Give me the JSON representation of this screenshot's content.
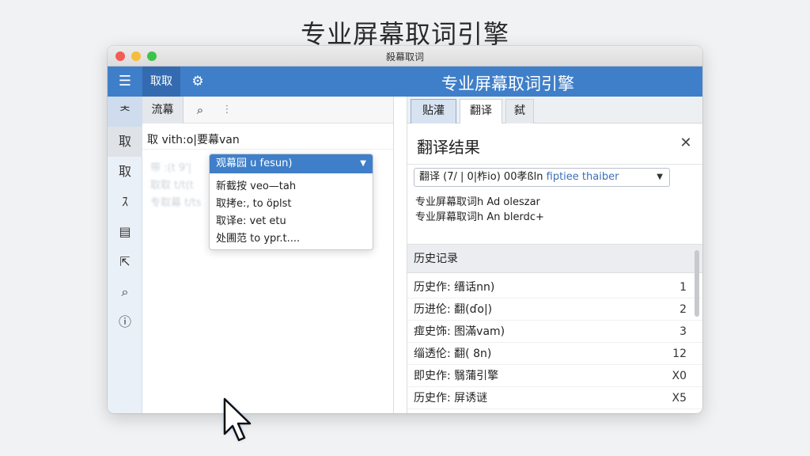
{
  "hero_title": "专业屏幕取词引擎",
  "window": {
    "title": "殺幕取词"
  },
  "appbar": {
    "menu_icon": "hamburger-icon",
    "tab_label": "取取",
    "settings_icon": "gear-icon",
    "title": "专业屏幕取词引擎"
  },
  "sidebar": {
    "items": [
      {
        "icon": "pin-icon",
        "glyph": "ᄎ"
      },
      {
        "label": "取"
      },
      {
        "label": "取"
      },
      {
        "label": "ｽ"
      },
      {
        "icon": "document-icon",
        "glyph": "▤"
      },
      {
        "icon": "export-icon",
        "glyph": "⇱"
      },
      {
        "icon": "search-doc-icon",
        "glyph": "⌕"
      },
      {
        "icon": "info-doc-icon",
        "glyph": "ⓘ"
      }
    ]
  },
  "left_panel": {
    "tab_label": "流幕",
    "search_icon": "search-icon",
    "query_text": "取 vith:o|要幕van",
    "ghost_lines": [
      "带 :(t 9'|",
      "取取 t/t(t",
      "专取幕 t/ts"
    ],
    "dropdown": {
      "selected": "观幕园 u fesun)",
      "items": [
        "新截按 veo—tah",
        "取拷e:, to öplst",
        "取译e:  vet etu",
        "处圃范  to ypr.t...."
      ]
    }
  },
  "right_panel": {
    "tabs": [
      "贴灌",
      "翻译",
      "弑"
    ],
    "title": "翻译结果",
    "select_prefix": "翻译 (7/ | 0|柞io) 00孝ßln ",
    "select_blue": "fiptiee thaiber",
    "result_lines": [
      "专业屏幕取词h Ad oleszar",
      "专业屏幕取词h An blerdc+"
    ]
  },
  "history": {
    "title": "历史记录",
    "rows": [
      {
        "text": "历史作:  缙话nn)",
        "count": "1"
      },
      {
        "text": "历进伦:  翻(ɗo|)",
        "count": "2"
      },
      {
        "text": "痖史饰:  图滿vam)",
        "count": "3"
      },
      {
        "text": "缁透伦:  翻( 8n)",
        "count": "12"
      },
      {
        "text": "即史作:  翳蒲引擎",
        "count": "X0"
      },
      {
        "text": "历史作:  屏诱谜",
        "count": "X5"
      }
    ]
  },
  "colors": {
    "accent": "#3f7fc9",
    "sidebar_bg": "#eaf0f7"
  }
}
